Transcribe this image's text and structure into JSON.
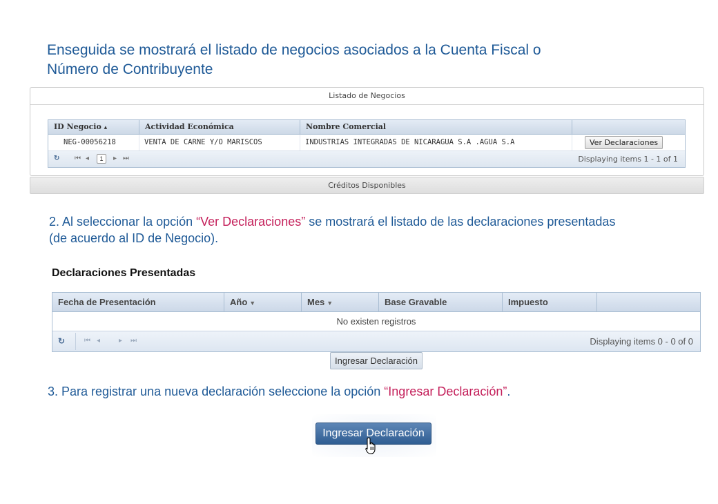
{
  "intro": {
    "line1": "Enseguida se mostrará el listado de negocios asociados a la Cuenta Fiscal o",
    "line2": "Número de Contribuyente"
  },
  "negocios_panel": {
    "title": "Listado de Negocios",
    "columns": [
      "ID Negocio",
      "Actividad Económica",
      "Nombre Comercial",
      ""
    ],
    "sort_indicator": "▴",
    "rows": [
      {
        "id": "NEG-00056218",
        "actividad": "VENTA DE CARNE Y/O MARISCOS",
        "nombre": "INDUSTRIAS INTEGRADAS DE NICARAGUA S.A .AGUA S.A",
        "action_label": "Ver Declaraciones"
      }
    ],
    "pager": {
      "page": "1",
      "display": "Displaying items 1 - 1 of 1"
    }
  },
  "creditos_panel": {
    "title": "Créditos Disponibles"
  },
  "step2": {
    "prefix": "2. Al seleccionar la opción ",
    "highlight": "“Ver Declaraciones”",
    "suffix": " se mostrará el listado de las declaraciones presentadas",
    "line2": "(de acuerdo al ID de Negocio)."
  },
  "declaraciones_panel": {
    "title": "Declaraciones Presentadas",
    "columns": [
      "Fecha de Presentación",
      "Año",
      "Mes",
      "Base Gravable",
      "Impuesto",
      ""
    ],
    "empty_message": "No existen registros",
    "pager": {
      "display": "Displaying items 0 - 0 of 0"
    },
    "button_label": "Ingresar Declaración"
  },
  "step3": {
    "prefix": "3. Para registrar una nueva declaración seleccione la opción ",
    "highlight": "“Ingresar Declaración”",
    "suffix": "."
  },
  "primary_button": {
    "label": "Ingresar Declaración"
  },
  "colors": {
    "text_blue": "#1f5a97",
    "highlight": "#c41f5a",
    "button_blue": "#2f5d92"
  }
}
